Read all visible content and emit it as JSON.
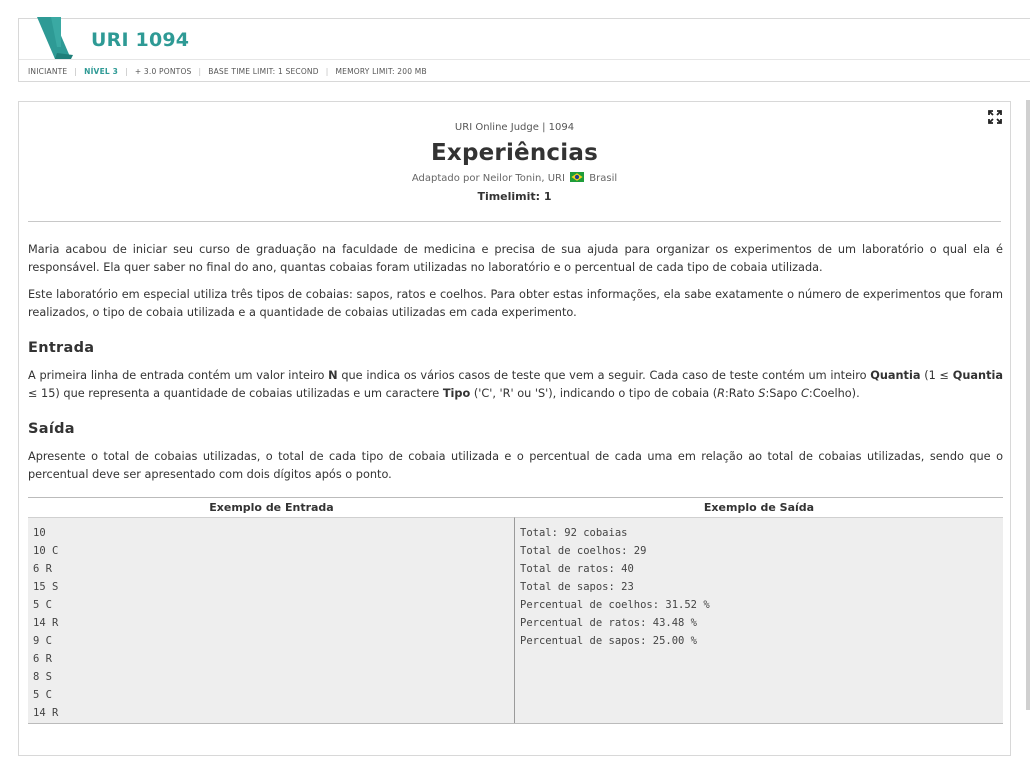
{
  "header": {
    "title": "URI 1094",
    "meta": {
      "category": "INICIANTE",
      "level": "NÍVEL 3",
      "points": "+ 3.0 PONTOS",
      "time_limit": "BASE TIME LIMIT: 1 SECOND",
      "memory_limit": "MEMORY LIMIT: 200 MB"
    }
  },
  "problem": {
    "source": "URI Online Judge | 1094",
    "title": "Experiências",
    "author_prefix": "Adaptado por Neilor Tonin, URI",
    "author_country": "Brasil",
    "timelimit": "Timelimit: 1",
    "description": [
      "Maria acabou de iniciar seu curso de graduação na faculdade de medicina e precisa de sua ajuda para organizar os experimentos de um laboratório o qual ela é responsável. Ela quer saber no final do ano, quantas cobaias foram utilizadas no laboratório e o percentual de cada tipo de cobaia utilizada.",
      "Este laboratório em especial utiliza três tipos de cobaias: sapos, ratos e coelhos. Para obter estas informações, ela sabe exatamente o número de experimentos que foram realizados, o tipo de cobaia utilizada e a quantidade de cobaias utilizadas em cada experimento."
    ],
    "input_title": "Entrada",
    "input_parts": {
      "p1": "A primeira linha de entrada contém um valor inteiro ",
      "b1": "N",
      "p2": " que indica os vários casos de teste que vem a seguir. Cada caso de teste contém um inteiro ",
      "b2": "Quantia",
      "p3": " (1 ≤ ",
      "b3": "Quantia",
      "p4": " ≤ 15) que representa a quantidade de cobaias utilizadas e um caractere ",
      "b4": "Tipo",
      "p5": " ('C', 'R' ou 'S'), indicando o tipo de cobaia (",
      "i1": "R",
      "p6": ":Rato ",
      "i2": "S",
      "p7": ":Sapo ",
      "i3": "C",
      "p8": ":Coelho)."
    },
    "output_title": "Saída",
    "output_text": "Apresente o total de cobaias utilizadas, o total de cada tipo de cobaia utilizada e o percentual de cada uma em relação ao total de cobaias utilizadas, sendo que o percentual deve ser apresentado com dois dígitos após o ponto."
  },
  "examples": {
    "input_header": "Exemplo de Entrada",
    "output_header": "Exemplo de Saída",
    "input_lines": [
      "10",
      "10 C",
      "6 R",
      "15 S",
      "5 C",
      "14 R",
      "9 C",
      "6 R",
      "8 S",
      "5 C",
      "14 R"
    ],
    "output_lines": [
      "Total: 92 cobaias",
      "Total de coelhos: 29",
      "Total de ratos: 40",
      "Total de sapos: 23",
      "Percentual de coelhos: 31.52 %",
      "Percentual de ratos: 43.48 %",
      "Percentual de sapos: 25.00 %"
    ]
  },
  "icons": {
    "logo": "uri-logo-icon",
    "flag": "brazil-flag-icon",
    "expand": "expand-icon"
  },
  "colors": {
    "accent": "#2e9a95"
  }
}
